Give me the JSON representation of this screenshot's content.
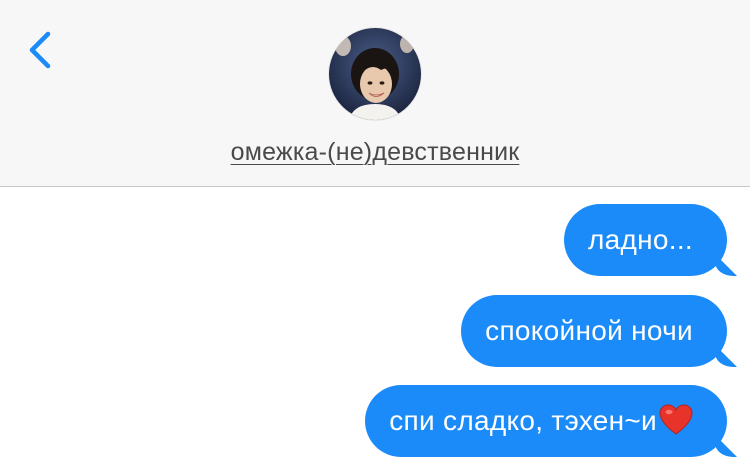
{
  "header": {
    "contact_name": "омежка-(не)девственник",
    "avatar_icon": "contact-photo"
  },
  "colors": {
    "accent": "#1b8bf9",
    "header_bg": "#f7f7f8",
    "bubble_text": "#ffffff"
  },
  "messages": [
    {
      "text": "ладно...",
      "direction": "outgoing"
    },
    {
      "text": "спокойной ночи",
      "direction": "outgoing"
    },
    {
      "text": "спи сладко, тэхен~и",
      "direction": "outgoing",
      "emoji": "red-heart-icon"
    }
  ]
}
